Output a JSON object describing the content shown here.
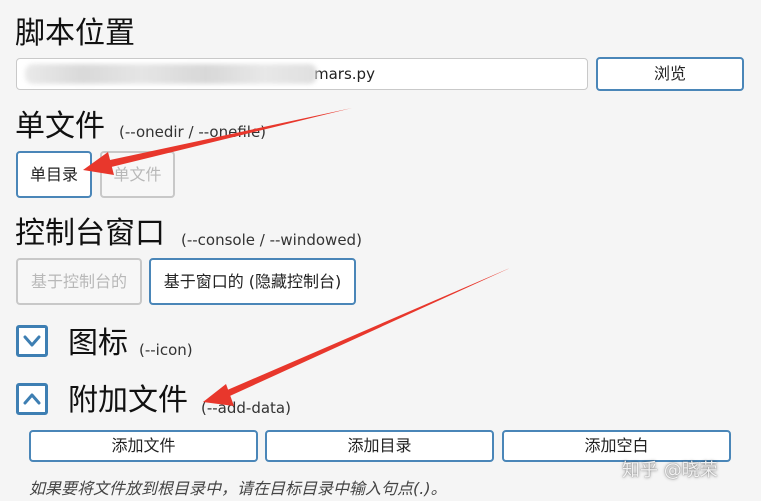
{
  "script_location": {
    "title": "脚本位置",
    "path_value": "mars.py",
    "browse_label": "浏览"
  },
  "onefile": {
    "title": "单文件",
    "flags": "(--onedir / --onefile)",
    "onedir_label": "单目录",
    "onefile_label": "单文件"
  },
  "console": {
    "title": "控制台窗口",
    "flags": "(--console / --windowed)",
    "console_label": "基于控制台的",
    "windowed_label": "基于窗口的 (隐藏控制台)"
  },
  "icon": {
    "title": "图标",
    "flags": "(--icon)"
  },
  "additional_files": {
    "title": "附加文件",
    "flags": "(--add-data)",
    "add_files_label": "添加文件",
    "add_folder_label": "添加目录",
    "add_blank_label": "添加空白",
    "hint": "如果要将文件放到根目录中，请在目标目录中输入句点(.)。"
  },
  "watermark": "知乎 @晓荣",
  "colors": {
    "accent": "#3e7fb3",
    "arrow": "#e8372c",
    "background": "#f5f5f5"
  }
}
